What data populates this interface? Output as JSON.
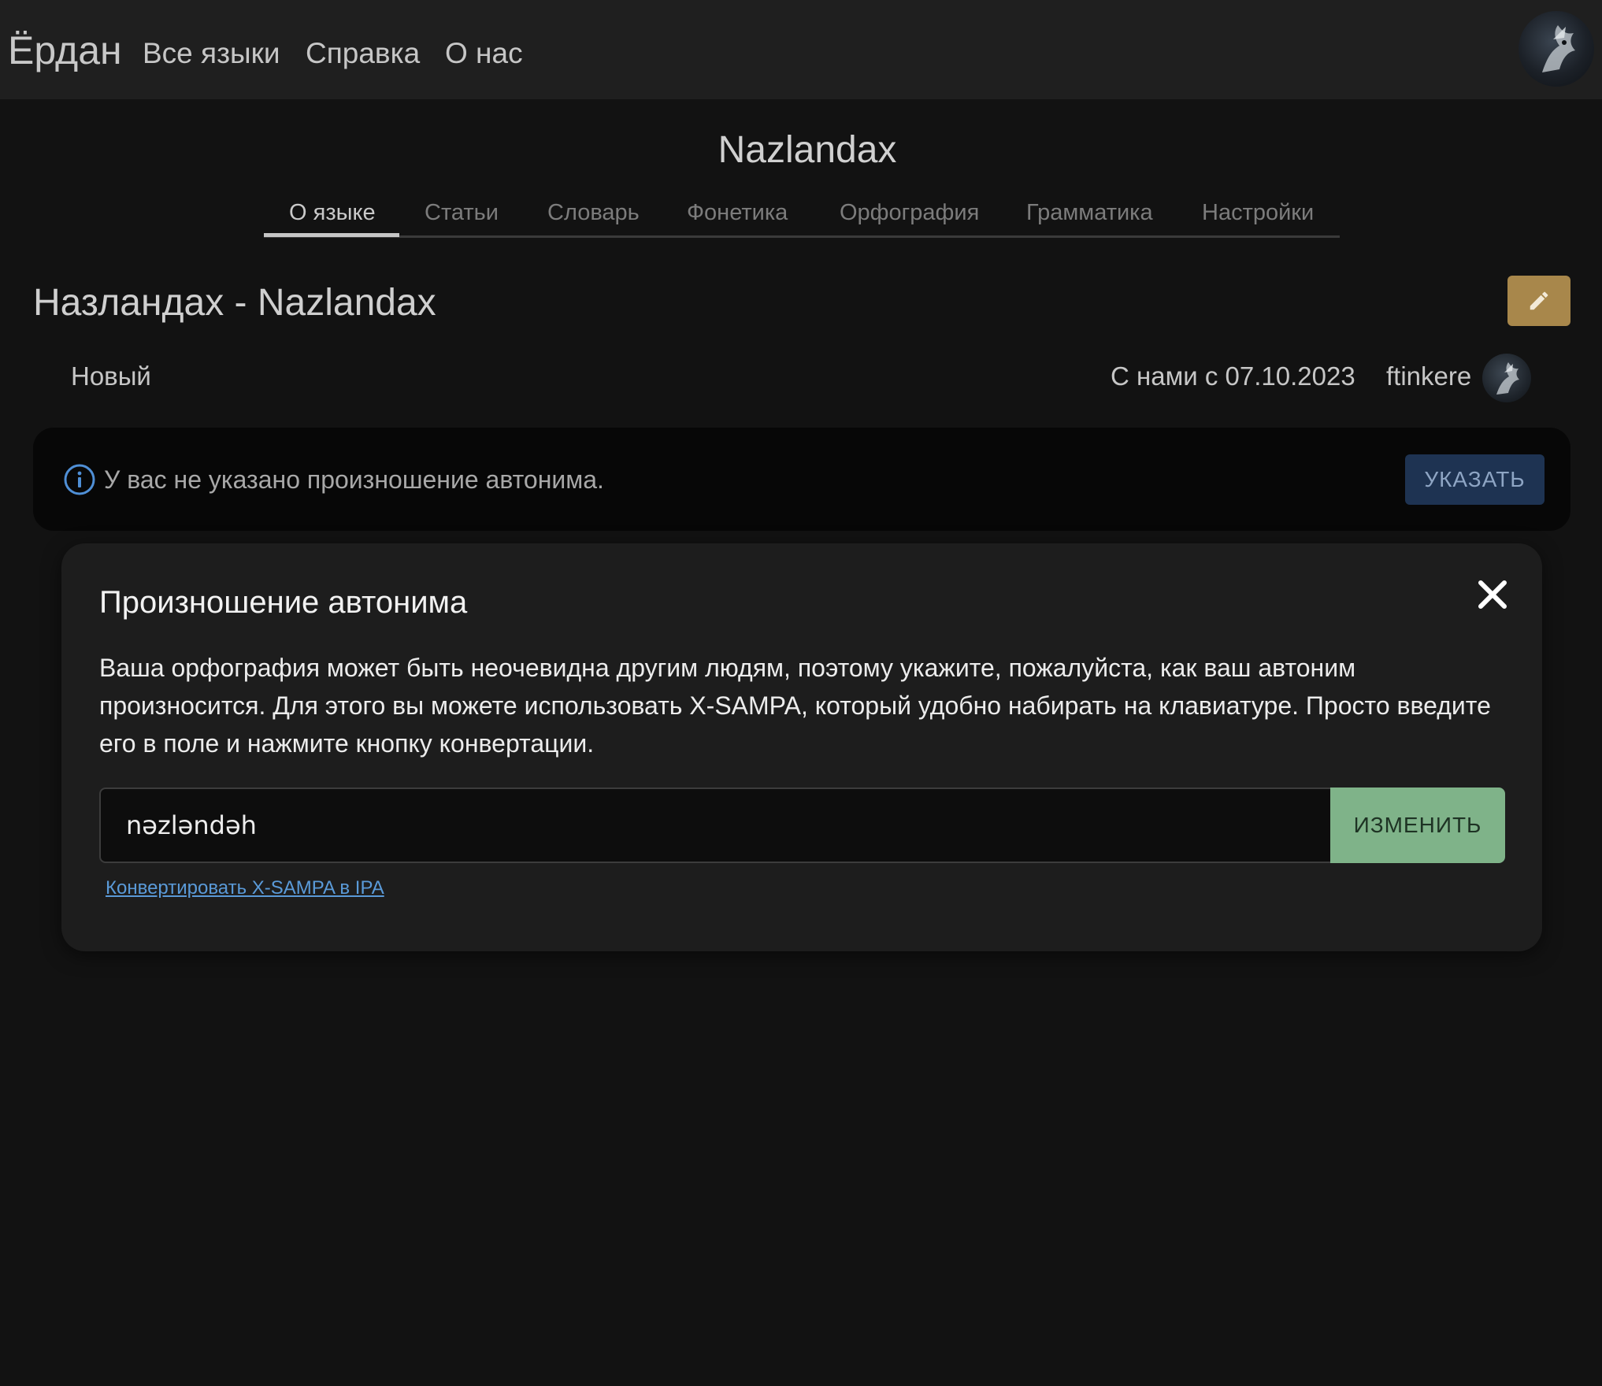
{
  "navbar": {
    "brand": "Ёрдан",
    "links": [
      "Все языки",
      "Справка",
      "О нас"
    ]
  },
  "language": {
    "title": "Nazlandax",
    "tabs": [
      "О языке",
      "Статьи",
      "Словарь",
      "Фонетика",
      "Орфография",
      "Грамматика",
      "Настройки"
    ],
    "active_tab": "О языке"
  },
  "page": {
    "heading": "Назландах - Nazlandax",
    "status": "Новый",
    "since": "С нами с 07.10.2023",
    "username": "ftinkere"
  },
  "alert": {
    "text": "У вас не указано произношение автонима.",
    "button": "УКАЗАТЬ"
  },
  "dialog": {
    "title": "Произношение автонима",
    "body": "Ваша орфография может быть неочевидна другим людям, поэтому укажите, пожалуйста, как ваш автоним произносится. Для этого вы можете использовать X-SAMPA, который удобно набирать на клавиатуре. Просто введите его в поле и нажмите кнопку конвертации.",
    "input_value": "nəzləndəh",
    "submit": "ИЗМЕНИТЬ",
    "link": "Конвертировать X-SAMPA в IPA"
  },
  "icons": {
    "edit": "pencil-icon",
    "info": "info-icon",
    "close": "close-icon"
  },
  "colors": {
    "background": "#121212",
    "navbar": "#1f1f1f",
    "edit_button": "#a8874b",
    "alert_button": "#1e3352",
    "submit_button": "#7fb389",
    "link": "#5a9ad8"
  }
}
